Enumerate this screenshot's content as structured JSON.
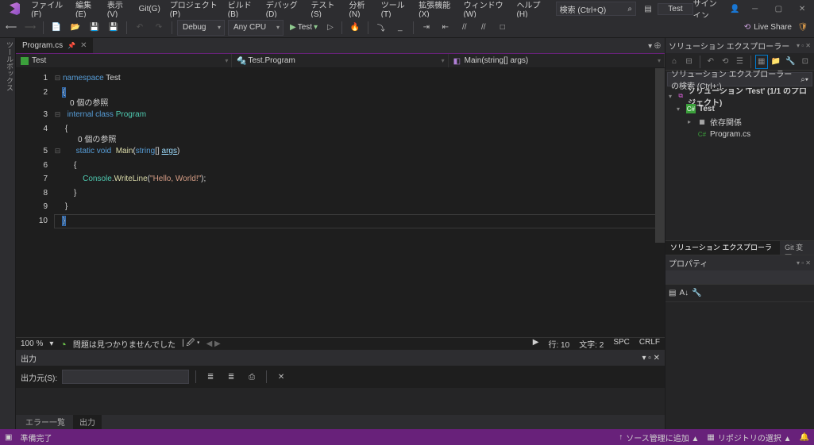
{
  "menu": {
    "file": "ファイル(F)",
    "edit": "編集(E)",
    "view": "表示(V)",
    "git": "Git(G)",
    "project": "プロジェクト(P)",
    "build": "ビルド(B)",
    "debug": "デバッグ(D)",
    "test": "テスト(S)",
    "analyze": "分析(N)",
    "tools": "ツール(T)",
    "ext": "拡張機能(X)",
    "window": "ウィンドウ(W)",
    "help": "ヘルプ(H)"
  },
  "search": {
    "placeholder": "検索 (Ctrl+Q)",
    "test_btn": "Test"
  },
  "account": {
    "signin": "サインイン"
  },
  "toolbar": {
    "config": "Debug",
    "platform": "Any CPU",
    "run": "Test",
    "liveshare": "Live Share"
  },
  "tabs": {
    "file": "Program.cs"
  },
  "navbar": {
    "proj": "Test",
    "cls": "Test.Program",
    "mth": "Main(string[] args)"
  },
  "code": {
    "lines": [
      "1",
      "2",
      "3",
      "4",
      "5",
      "6",
      "7",
      "8",
      "9",
      "10"
    ],
    "ref1": "0 個の参照",
    "ref2": "0 個の参照",
    "ns": "namespace ",
    "nsname": "Test",
    "obrace": "{",
    "cbrace": "}",
    "internal": "internal ",
    "class": "class ",
    "Program": "Program",
    "static": "static ",
    "void": "void ",
    "Main": "Main",
    "args_sig": "(",
    "string": "string",
    "brackets": "[] ",
    "args": "args",
    "closep": ")",
    "console": "Console",
    "dot": ".",
    "writeline": "WriteLine",
    "paren_o": "(",
    "hello": "\"Hello, World!\"",
    "paren_c": ");"
  },
  "editor_status": {
    "zoom": "100 %",
    "issues": "問題は見つかりませんでした",
    "line": "行: 10",
    "char": "文字: 2",
    "ins": "SPC",
    "eol": "CRLF"
  },
  "output": {
    "title": "出力",
    "from_label": "出力元(S):",
    "tabs": {
      "errors": "エラー一覧",
      "output": "出力"
    }
  },
  "solution": {
    "title": "ソリューション エクスプローラー",
    "search": "ソリューション エクスプローラー の検索 (Ctrl+;)",
    "root": "ソリューション 'Test' (1/1 のプロジェクト)",
    "proj": "Test",
    "deps": "依存関係",
    "file": "Program.cs",
    "tabs": {
      "sol": "ソリューション エクスプローラー",
      "git": "Git 変更"
    }
  },
  "props": {
    "title": "プロパティ"
  },
  "statusbar": {
    "ready": "準備完了",
    "addscm": "ソース管理に追加 ▲",
    "repo": "リポジトリの選択 ▲"
  }
}
